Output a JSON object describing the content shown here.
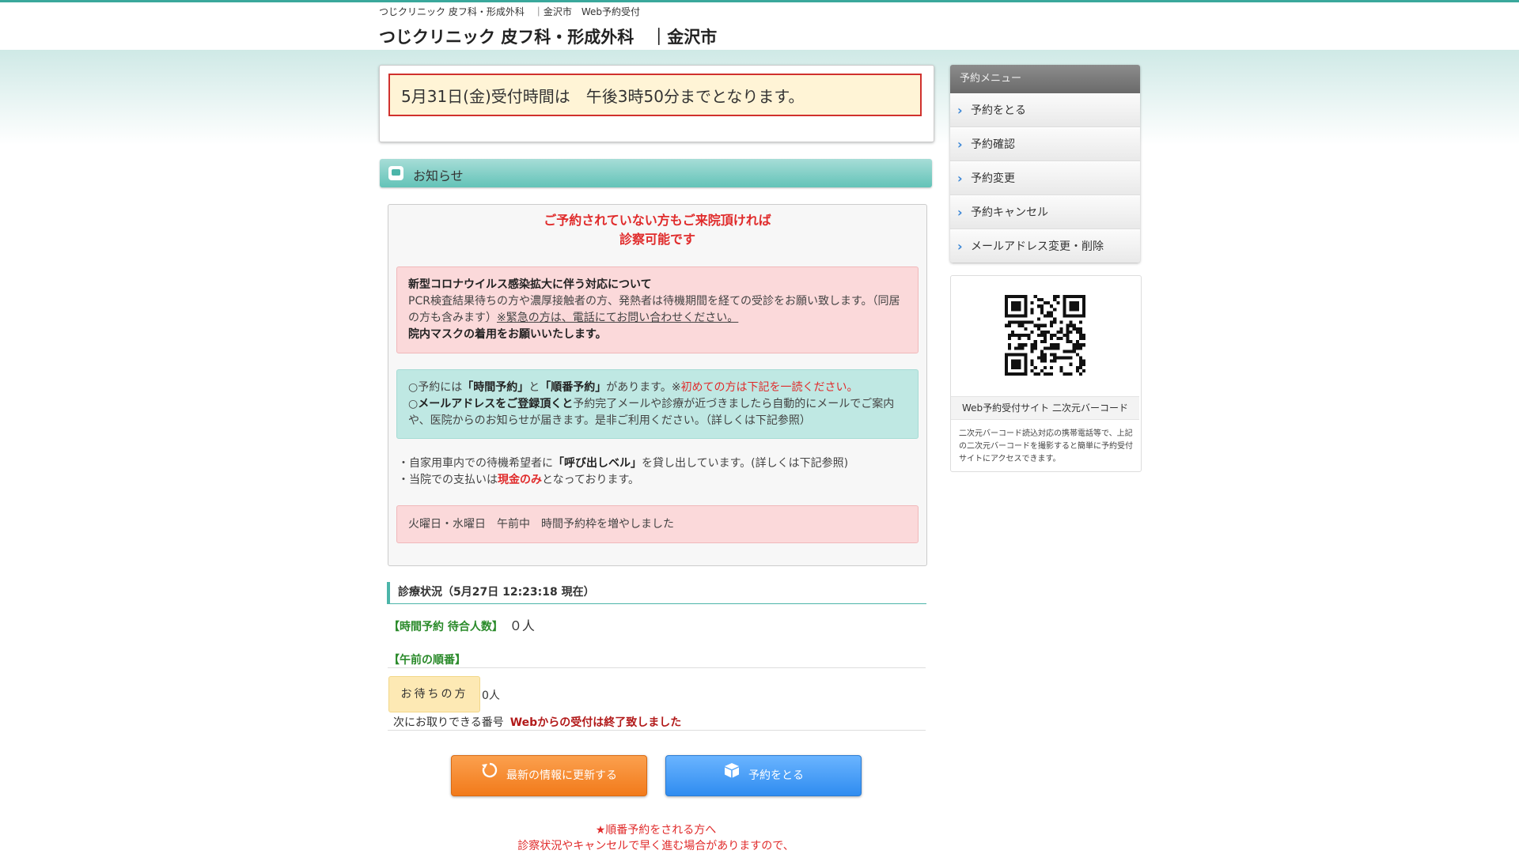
{
  "header": {
    "small_title": "つじクリニック 皮フ科・形成外科　｜金沢市　Web予約受付",
    "site_title": "つじクリニック 皮フ科・形成外科　｜金沢市"
  },
  "notice": {
    "text": "5月31日(金)受付時間は　午後3時50分までとなります。"
  },
  "news": {
    "section_label": "お知らせ",
    "red_line1": "ご予約されていない方もご来院頂ければ",
    "red_line2": "診察可能です",
    "covid_title": "新型コロナウイルス感染拡大に伴う対応について",
    "covid_body": "PCR検査結果待ちの方や濃厚接触者の方、発熱者は待機期間を経ての受診をお願い致します。（同居の方も含みます）",
    "covid_emergency": "※緊急の方は、電話にてお問い合わせください。",
    "covid_mask": "院内マスクの着用をお願いいたします。",
    "teal_line1_a": "○予約には",
    "teal_line1_b": "「時間予約」",
    "teal_line1_c": "と",
    "teal_line1_d": "「順番予約」",
    "teal_line1_e": "があります。※",
    "teal_line1_f": "初めての方は下記を一読ください。",
    "teal_line2_a": "○",
    "teal_line2_b": "メールアドレスをご登録頂くと",
    "teal_line2_c": "予約完了メールや診療が近づきましたら自動的にメールでご案内や、医院からのお知らせが届きます。是非ご利用ください。（詳しくは下記参照）",
    "bell_a": "・自家用車内での待機希望者に",
    "bell_b": "「呼び出しベル」",
    "bell_c": "を貸し出しています。(詳しくは下記参照)",
    "pay_a": "・当院での支払いは",
    "pay_b": "現金のみ",
    "pay_c": "となっております。",
    "pink2_text": "火曜日・水曜日　午前中　時間予約枠を増やしました"
  },
  "status": {
    "heading": "診療状況（5月27日 12:23:18 現在）",
    "time_label": "【時間予約 待合人数】",
    "time_value": "０人",
    "morning_label": "【午前の順番】",
    "waiting_label": "お待ちの方",
    "waiting_value": "0人",
    "next_label": "次にお取りできる番号",
    "next_value": "Webからの受付は終了致しました"
  },
  "buttons": {
    "refresh": "最新の情報に更新する",
    "reserve": "予約をとる"
  },
  "footer": {
    "line1": "★順番予約をされる方へ",
    "line2": "診察状況やキャンセルで早く進む場合がありますので、"
  },
  "sidebar": {
    "title": "予約メニュー",
    "items": [
      {
        "label": "予約をとる"
      },
      {
        "label": "予約確認"
      },
      {
        "label": "予約変更"
      },
      {
        "label": "予約キャンセル"
      },
      {
        "label": "メールアドレス変更・削除"
      }
    ]
  },
  "qr": {
    "caption": "Web予約受付サイト 二次元バーコード",
    "desc": "二次元バーコード読込対応の携帯電話等で、上記の二次元バーコードを撮影すると簡単に予約受付サイトにアクセスできます。"
  },
  "colors": {
    "accent": "#4cb5a9",
    "alert_red": "#e02b2b",
    "button_orange": "#f27a1a",
    "button_blue": "#2f8cf0"
  }
}
